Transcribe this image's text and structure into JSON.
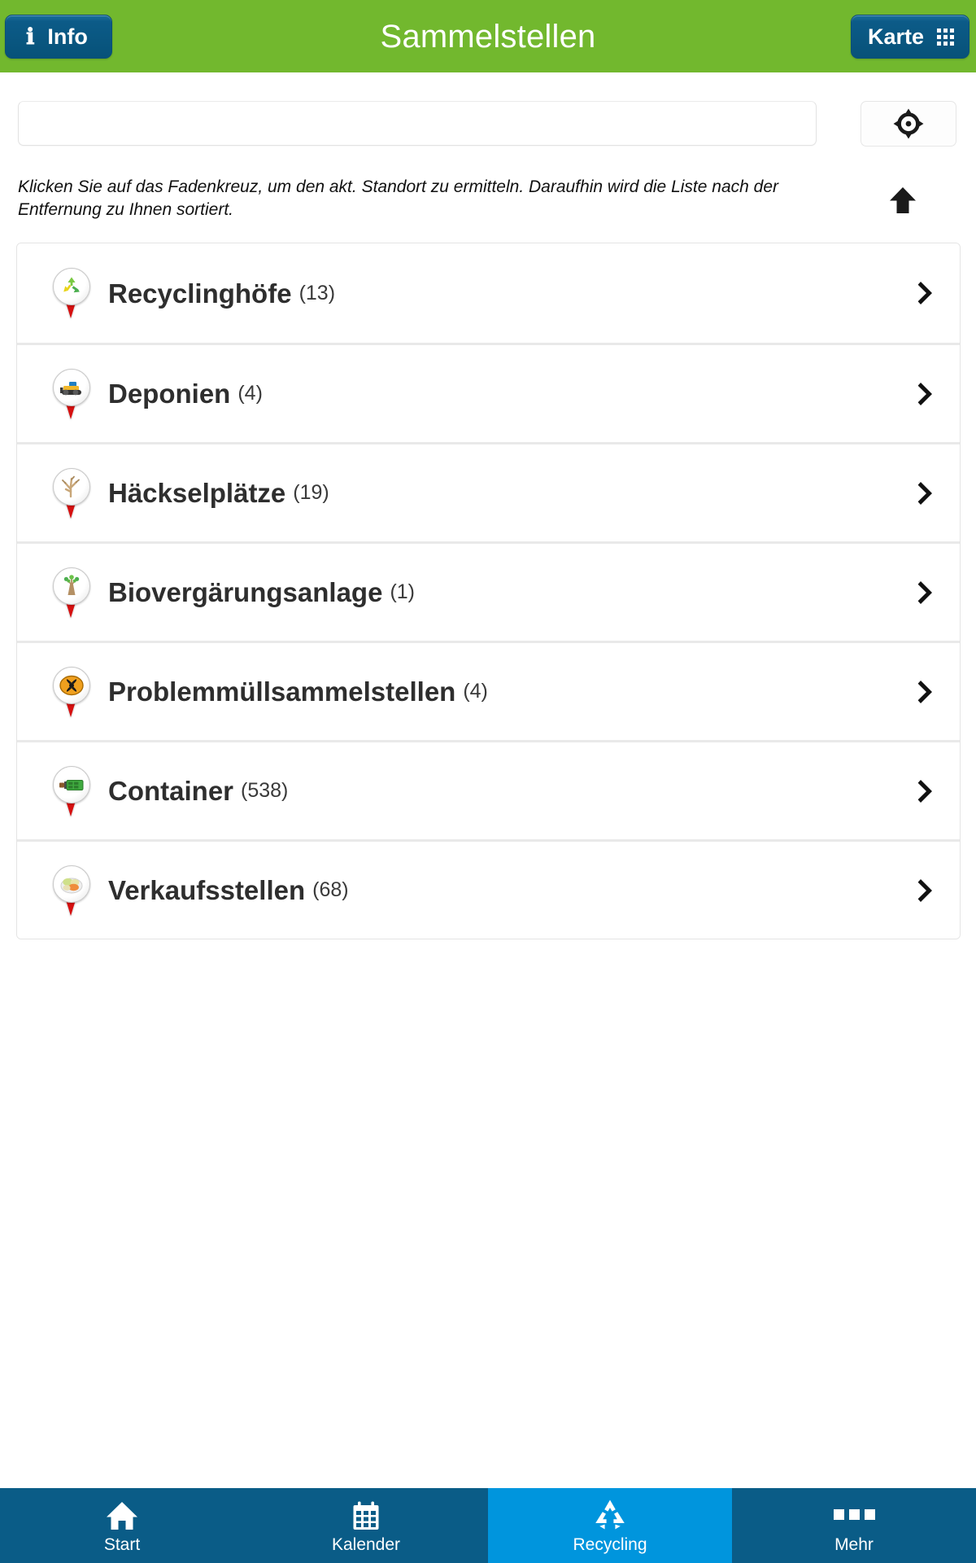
{
  "header": {
    "title": "Sammelstellen",
    "info_label": "Info",
    "info_icon": "info-icon",
    "map_label": "Karte",
    "map_icon": "grid-icon",
    "background_color": "#72b82e",
    "button_color": "#0c5b88"
  },
  "search": {
    "value": "",
    "placeholder": "",
    "locate_icon": "crosshair-icon",
    "sort_icon": "arrow-up-icon"
  },
  "hint": {
    "text": "Klicken Sie auf das Fadenkreuz, um den akt. Standort zu ermitteln. Daraufhin wird die Liste nach der Entfernung zu Ihnen sortiert."
  },
  "list": {
    "items": [
      {
        "label": "Recyclinghöfe",
        "count": "(13)",
        "icon": "recycling-pin-icon"
      },
      {
        "label": "Deponien",
        "count": "(4)",
        "icon": "bulldozer-pin-icon"
      },
      {
        "label": "Häckselplätze",
        "count": "(19)",
        "icon": "branches-pin-icon"
      },
      {
        "label": "Biovergärungsanlage",
        "count": "(1)",
        "icon": "sapling-pin-icon"
      },
      {
        "label": "Problemmüllsammelstellen",
        "count": "(4)",
        "icon": "hazard-pin-icon"
      },
      {
        "label": "Container",
        "count": "(538)",
        "icon": "container-pin-icon"
      },
      {
        "label": "Verkaufsstellen",
        "count": "(68)",
        "icon": "produce-pin-icon"
      }
    ],
    "chevron_icon": "chevron-right-icon"
  },
  "tabbar": {
    "active_index": 2,
    "active_color": "#0095dd",
    "background_color": "#0a5c87",
    "items": [
      {
        "label": "Start",
        "icon": "home-icon"
      },
      {
        "label": "Kalender",
        "icon": "calendar-icon"
      },
      {
        "label": "Recycling",
        "icon": "recycling-icon"
      },
      {
        "label": "Mehr",
        "icon": "ellipsis-icon"
      }
    ]
  }
}
